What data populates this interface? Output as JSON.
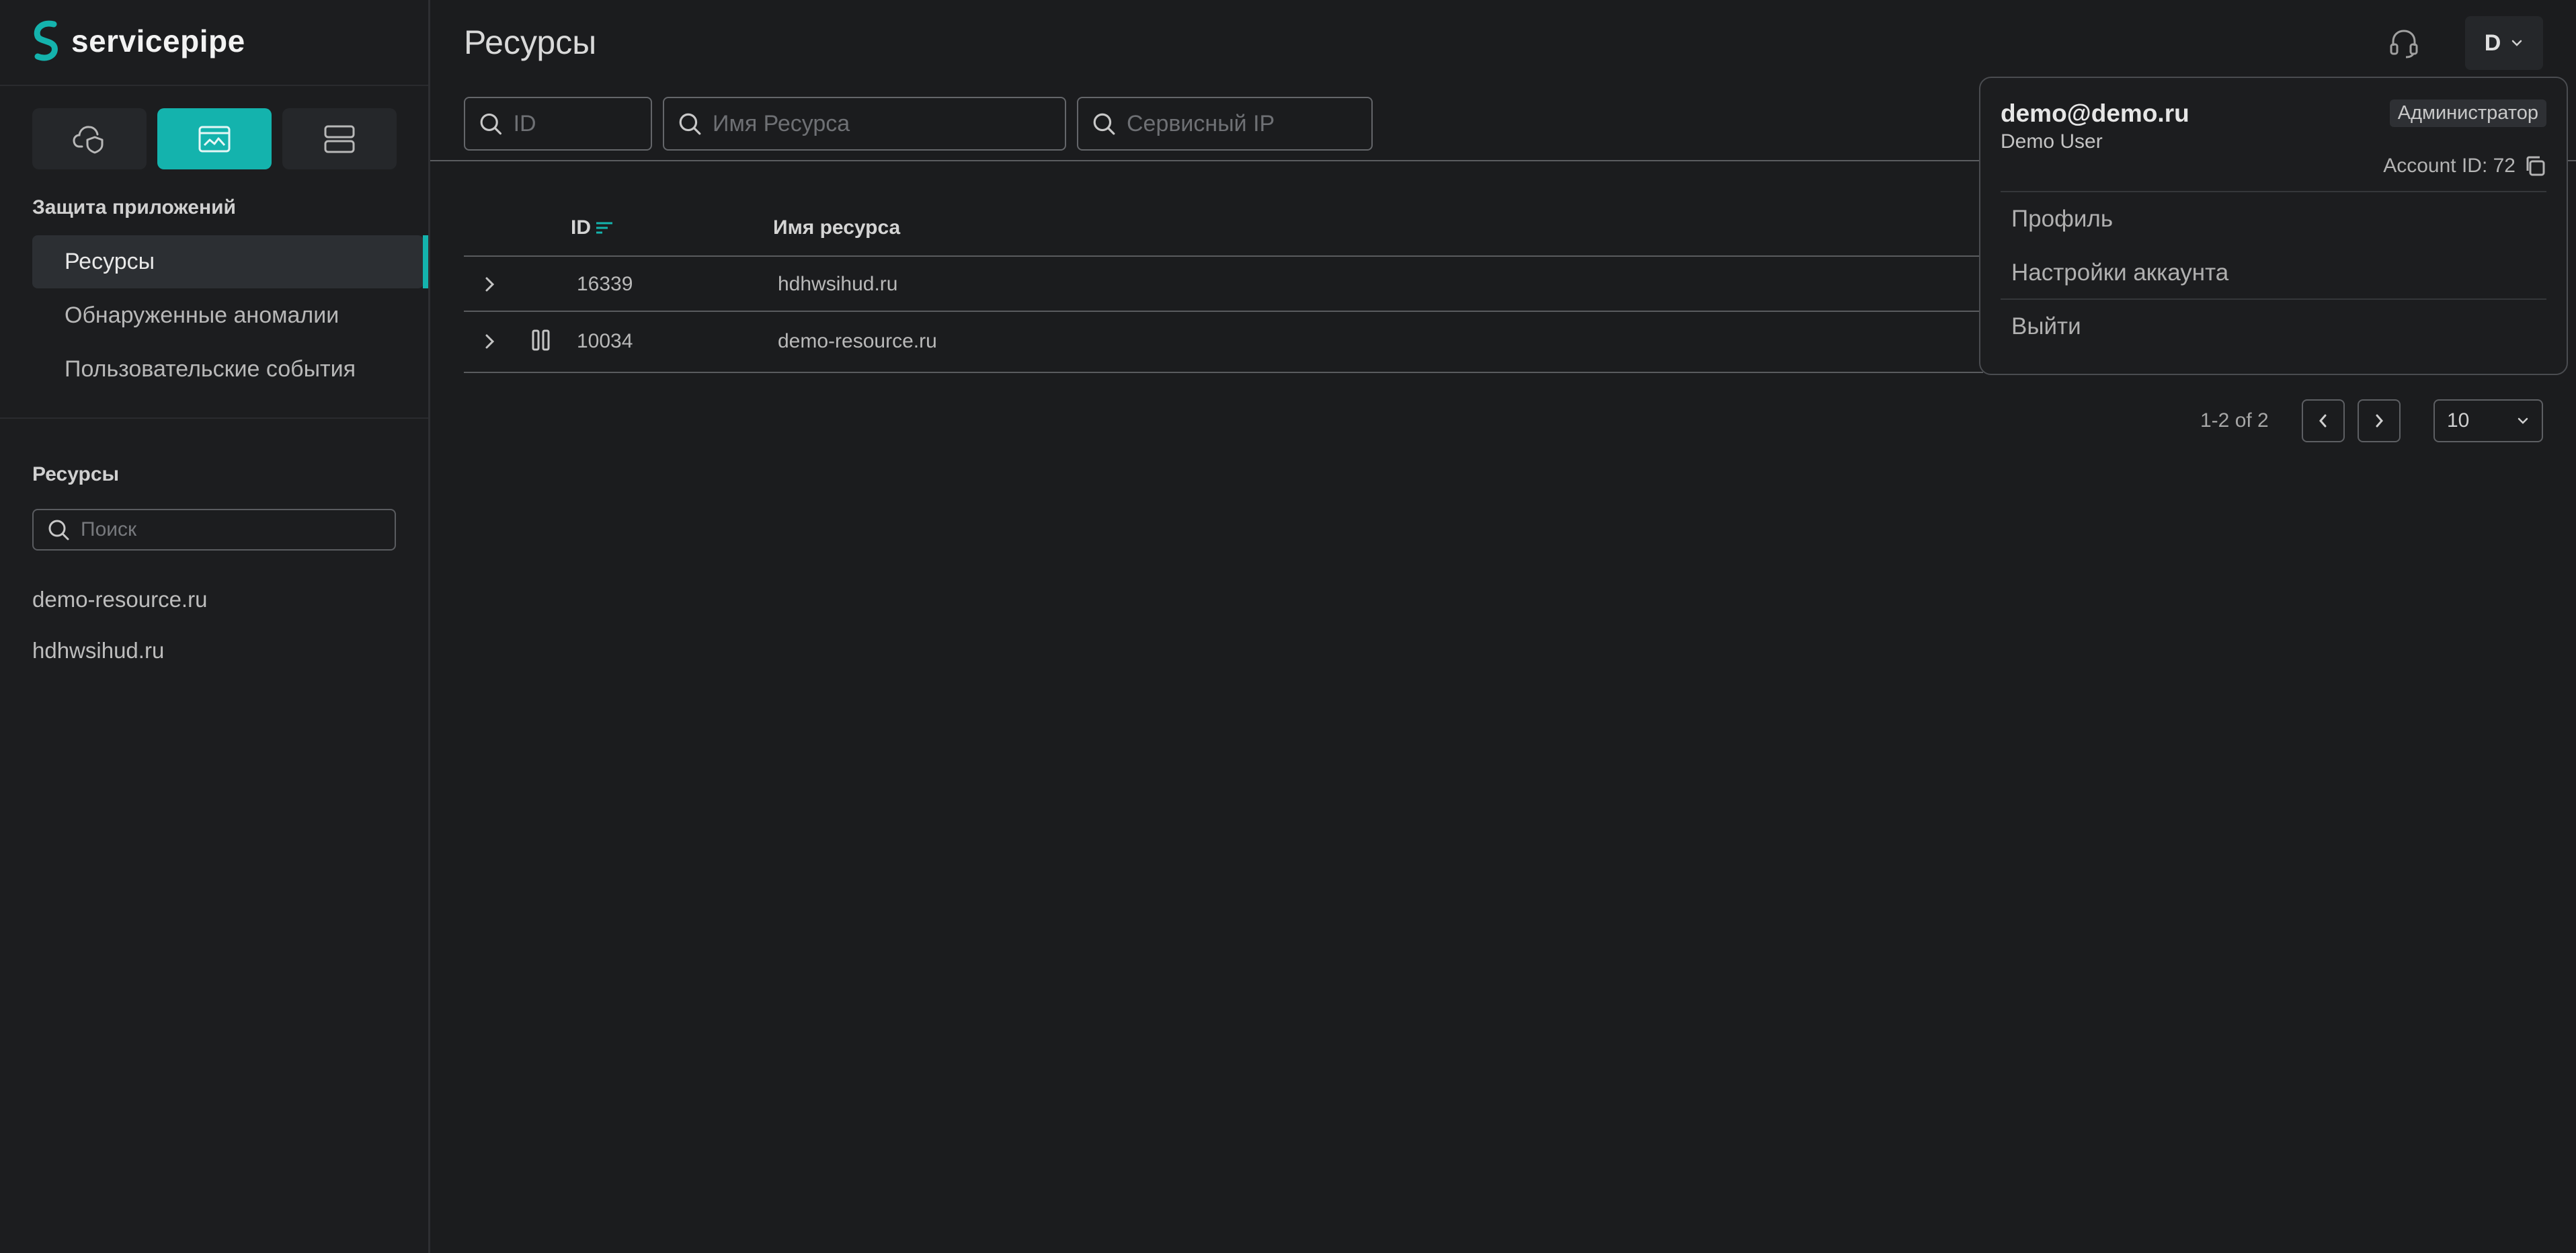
{
  "app": {
    "brand": "servicepipe",
    "accent_color": "#14b3ad"
  },
  "sidebar": {
    "mode_buttons": [
      {
        "icon": "cloud-shield-icon",
        "active": false
      },
      {
        "icon": "browser-window-icon",
        "active": true
      },
      {
        "icon": "server-icon",
        "active": false
      }
    ],
    "section_heading": "Защита приложений",
    "nav_items": [
      {
        "label": "Ресурсы",
        "active": true
      },
      {
        "label": "Обнаруженные аномалии",
        "active": false
      },
      {
        "label": "Пользовательские события",
        "active": false
      }
    ],
    "resources_heading": "Ресурсы",
    "search_placeholder": "Поиск",
    "resources": [
      "demo-resource.ru",
      "hdhwsihud.ru"
    ]
  },
  "header": {
    "title": "Ресурсы",
    "support_icon": "headset-icon",
    "user_initial": "D"
  },
  "filters": {
    "id_placeholder": "ID",
    "name_placeholder": "Имя Ресурса",
    "ip_placeholder": "Сервисный IP"
  },
  "table": {
    "columns": {
      "id": "ID",
      "name": "Имя ресурса"
    },
    "rows": [
      {
        "id": "16339",
        "name": "hdhwsihud.ru",
        "paused": false
      },
      {
        "id": "10034",
        "name": "demo-resource.ru",
        "paused": true
      }
    ]
  },
  "pagination": {
    "range_text": "1-2 of 2",
    "page_size": "10"
  },
  "user_menu": {
    "email": "demo@demo.ru",
    "name": "Demo User",
    "role": "Администратор",
    "account_id": "Account ID: 72",
    "items": [
      "Профиль",
      "Настройки аккаунта",
      "Выйти"
    ]
  }
}
